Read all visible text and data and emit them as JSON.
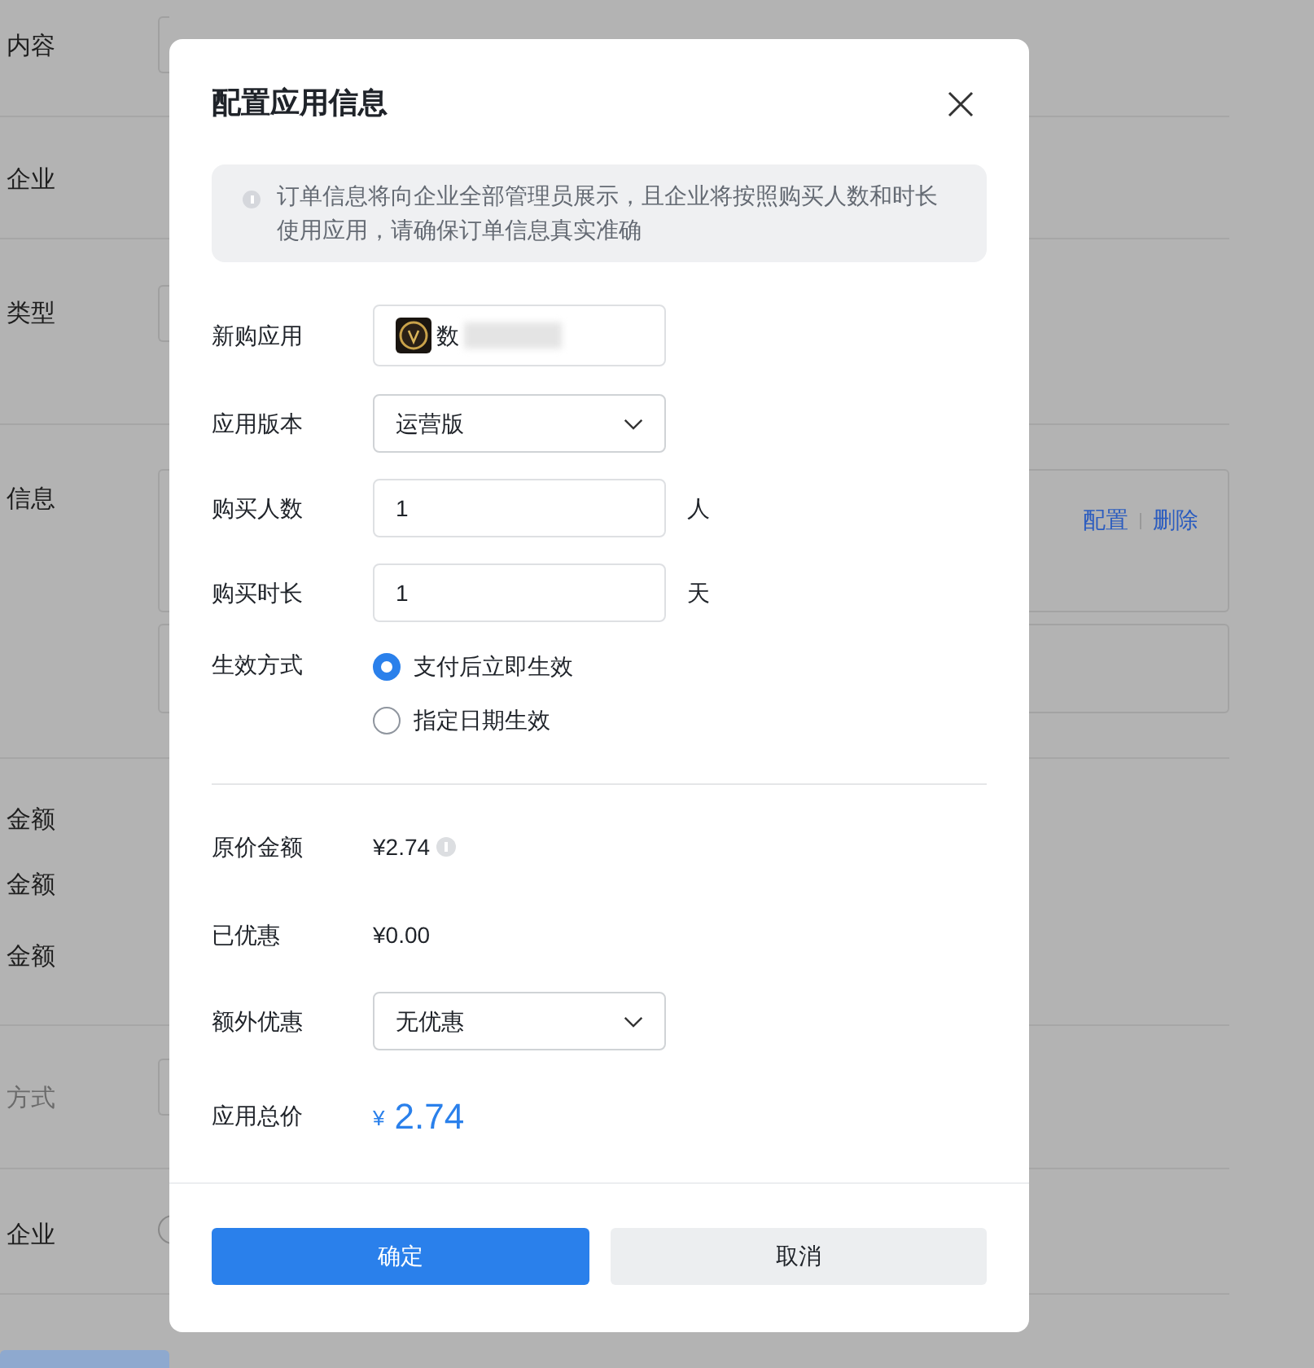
{
  "background_page": {
    "rows": [
      {
        "label": "内容",
        "kind": "field"
      },
      {
        "label": "企业",
        "kind": "plain"
      },
      {
        "label": "类型",
        "kind": "field"
      },
      {
        "label": "信息",
        "kind": "app_boxes",
        "links": [
          "配置",
          "删除"
        ]
      },
      {
        "label": "金额",
        "kind": "amounts",
        "extra_labels": [
          "金额",
          "金额"
        ]
      },
      {
        "label": "方式",
        "kind": "field",
        "disabled": true
      },
      {
        "label": "企业",
        "kind": "radio",
        "selected": false
      }
    ]
  },
  "dialog": {
    "title": "配置应用信息",
    "notice": "订单信息将向企业全部管理员展示，且企业将按照购买人数和时长使用应用，请确保订单信息真实准确",
    "fields": [
      {
        "kind": "app",
        "label": "新购应用",
        "value": "数"
      },
      {
        "kind": "select",
        "label": "应用版本",
        "value": "运营版"
      },
      {
        "kind": "number",
        "label": "购买人数",
        "value": "1",
        "unit": "人"
      },
      {
        "kind": "number",
        "label": "购买时长",
        "value": "1",
        "unit": "天"
      },
      {
        "kind": "radio",
        "label": "生效方式",
        "options": [
          {
            "label": "支付后立即生效",
            "selected": true
          },
          {
            "label": "指定日期生效",
            "selected": false
          }
        ]
      }
    ],
    "prices": [
      {
        "kind": "text",
        "label": "原价金额",
        "value": "¥2.74",
        "info": true
      },
      {
        "kind": "text",
        "label": "已优惠",
        "value": "¥0.00",
        "info": false
      },
      {
        "kind": "select",
        "label": "额外优惠",
        "value": "无优惠"
      },
      {
        "kind": "total",
        "label": "应用总价",
        "currency": "¥",
        "value": "2.74"
      }
    ],
    "buttons": [
      {
        "label": "确定",
        "kind": "primary"
      },
      {
        "label": "取消",
        "kind": "secondary"
      }
    ]
  }
}
